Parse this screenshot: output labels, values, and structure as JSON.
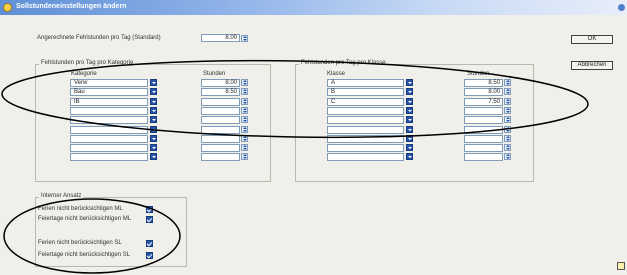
{
  "window": {
    "title": "Sollstundeneinstellungen ändern"
  },
  "top": {
    "label": "Angerechnete Fehlstunden pro Tag (Standard)",
    "value": "8.00"
  },
  "buttons": {
    "ok": "OK",
    "cancel": "Abbrechen"
  },
  "kategorie_group": {
    "title": "Fehlstunden pro Tag pro Kategorie",
    "col_kategorie": "Kategorie",
    "col_stunden": "Stunden",
    "rows": [
      {
        "kategorie": "Verw",
        "stunden": "8.00"
      },
      {
        "kategorie": "Bau",
        "stunden": "8.50"
      },
      {
        "kategorie": "IB",
        "stunden": ""
      },
      {
        "kategorie": "",
        "stunden": ""
      },
      {
        "kategorie": "",
        "stunden": ""
      },
      {
        "kategorie": "",
        "stunden": ""
      },
      {
        "kategorie": "",
        "stunden": ""
      },
      {
        "kategorie": "",
        "stunden": ""
      },
      {
        "kategorie": "",
        "stunden": ""
      }
    ]
  },
  "klasse_group": {
    "title": "Fehlstunden pro Tag pro Klasse",
    "col_klasse": "Klasse",
    "col_stunden": "Stunden",
    "rows": [
      {
        "klasse": "A",
        "stunden": "8.50"
      },
      {
        "klasse": "B",
        "stunden": "8.00"
      },
      {
        "klasse": "C",
        "stunden": "7.50"
      },
      {
        "klasse": "",
        "stunden": ""
      },
      {
        "klasse": "",
        "stunden": ""
      },
      {
        "klasse": "",
        "stunden": ""
      },
      {
        "klasse": "",
        "stunden": ""
      },
      {
        "klasse": "",
        "stunden": ""
      },
      {
        "klasse": "",
        "stunden": ""
      }
    ]
  },
  "ansatz_group": {
    "title": "Interner Ansatz",
    "items": [
      {
        "label": "Ferien nicht berücksichtigen ML",
        "checked": true
      },
      {
        "label": "Feiertage nicht berücksichtigen ML",
        "checked": true
      },
      {
        "label": "Ferien nicht berücksichtigen SL",
        "checked": true
      },
      {
        "label": "Feiertage nicht berücksichtigen SL",
        "checked": true
      }
    ]
  },
  "colors": {
    "titlebar": "#5f8fd6",
    "annotation": "#000000",
    "dropdown": "#2a55a8"
  }
}
